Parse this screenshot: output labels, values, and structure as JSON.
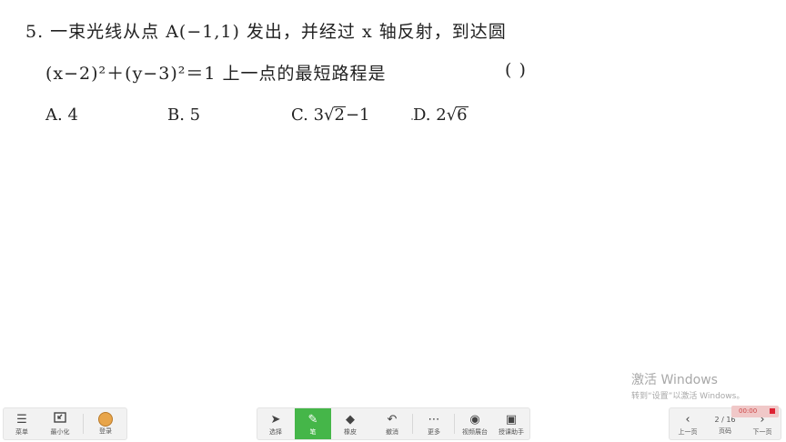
{
  "question": {
    "line1": "5. 一束光线从点 A(−1,1) 发出，并经过 x 轴反射，到达圆",
    "line2": "(x−2)²＋(y−3)²＝1 上一点的最短路程是",
    "answer_paren": "(      )",
    "choices": {
      "a": "A. 4",
      "b": "B. 5",
      "c_prefix": "C. 3",
      "c_radicand": "2",
      "c_suffix": "−1",
      "d_prefix": "D. 2",
      "d_radicand": "6"
    }
  },
  "toolbar": {
    "left": {
      "menu": "菜单",
      "minimize": "最小化",
      "login": "登录"
    },
    "middle": {
      "select": "选择",
      "pen": "笔",
      "eraser": "橡皮",
      "undo": "撤消",
      "more": "更多",
      "video_booth": "视频展台",
      "teaching_assistant": "授课助手"
    },
    "right": {
      "prev": "上一页",
      "page_label": "页码",
      "page_value": "2 / 16",
      "next": "下一页"
    },
    "active_tool": "pen",
    "active_color": "#45b649"
  },
  "timer": {
    "text": "00:00"
  },
  "watermark": {
    "title": "激活 Windows",
    "subtitle": "转到“设置”以激活 Windows。"
  },
  "icons": [
    "menu-icon",
    "minimize-icon",
    "avatar-icon",
    "cursor-icon",
    "pen-icon",
    "eraser-icon",
    "undo-icon",
    "more-icon",
    "camera-icon",
    "assistant-icon",
    "chevron-left-icon",
    "chevron-right-icon",
    "stop-icon"
  ]
}
